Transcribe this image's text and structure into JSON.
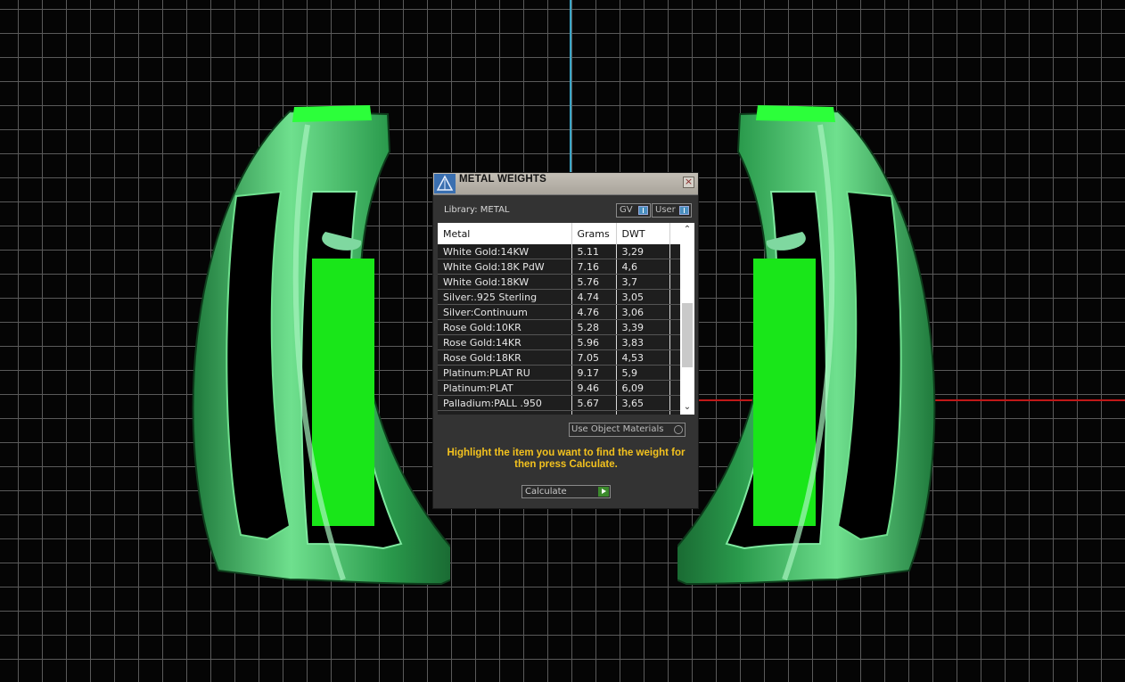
{
  "dialog": {
    "title": "METAL WEIGHTS",
    "library_label": "Library: METAL",
    "gv_label": "GV",
    "user_label": "User",
    "columns": [
      "Metal",
      "Grams",
      "DWT"
    ],
    "rows": [
      [
        "White Gold:14KW",
        "5.11",
        "3,29"
      ],
      [
        "White Gold:18K PdW",
        "7.16",
        "4,6"
      ],
      [
        "White Gold:18KW",
        "5.76",
        "3,7"
      ],
      [
        "Silver:.925 Sterling",
        "4.74",
        "3,05"
      ],
      [
        "Silver:Continuum",
        "4.76",
        "3,06"
      ],
      [
        "Rose Gold:10KR",
        "5.28",
        "3,39"
      ],
      [
        "Rose Gold:14KR",
        "5.96",
        "3,83"
      ],
      [
        "Rose Gold:18KR",
        "7.05",
        "4,53"
      ],
      [
        "Platinum:PLAT RU",
        "9.17",
        "5,9"
      ],
      [
        "Platinum:PLAT",
        "9.46",
        "6,09"
      ],
      [
        "Palladium:PALL .950",
        "5.67",
        "3,65"
      ]
    ],
    "use_object_materials_label": "Use Object Materials",
    "hint": "Highlight the item you want to find the weight for then press Calculate.",
    "calculate_label": "Calculate"
  },
  "colors": {
    "ring_green": "#2fb45a",
    "ring_bright": "#19e619",
    "hint_yellow": "#f3c21e",
    "axis_blue": "#3aa6c8",
    "axis_red": "#c01818"
  }
}
